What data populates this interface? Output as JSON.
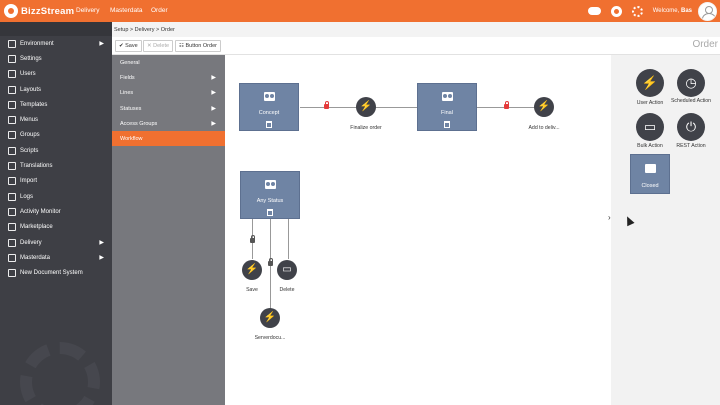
{
  "app": {
    "name": "BizzStream"
  },
  "topnav": [
    {
      "label": "Delivery"
    },
    {
      "label": "Masterdata"
    },
    {
      "label": "Order"
    }
  ],
  "user": {
    "welcome": "Welcome,",
    "name": "Bas"
  },
  "icons": {
    "cloud": "cloud-icon",
    "help": "lifebuoy-icon",
    "settings": "gear-icon"
  },
  "colors": {
    "accent": "#f07030",
    "sidebar": "#3e3f45",
    "subnav": "#77787d",
    "node": "#6f84a4",
    "action": "#404249",
    "lock": "#e53b3b"
  },
  "sidebar": {
    "items": [
      {
        "label": "Environment",
        "icon": "globe-icon",
        "has_children": true
      },
      {
        "label": "Settings",
        "icon": "wrench-icon",
        "has_children": false
      },
      {
        "label": "Users",
        "icon": "users-icon",
        "has_children": false
      },
      {
        "label": "Layouts",
        "icon": "layout-icon",
        "has_children": false
      },
      {
        "label": "Templates",
        "icon": "template-icon",
        "has_children": false
      },
      {
        "label": "Menus",
        "icon": "menu-icon",
        "has_children": false
      },
      {
        "label": "Groups",
        "icon": "groups-icon",
        "has_children": false
      },
      {
        "label": "Scripts",
        "icon": "code-icon",
        "has_children": false
      },
      {
        "label": "Translations",
        "icon": "translate-icon",
        "has_children": false
      },
      {
        "label": "Import",
        "icon": "import-icon",
        "has_children": false
      },
      {
        "label": "Logs",
        "icon": "log-icon",
        "has_children": false
      },
      {
        "label": "Activity Monitor",
        "icon": "monitor-icon",
        "has_children": false
      },
      {
        "label": "Marketplace",
        "icon": "cart-icon",
        "has_children": false
      },
      {
        "label": "Delivery",
        "icon": "truck-icon",
        "has_children": true
      },
      {
        "label": "Masterdata",
        "icon": "database-icon",
        "has_children": true
      },
      {
        "label": "New Document System",
        "icon": "plus-icon",
        "has_children": false
      }
    ]
  },
  "breadcrumb": {
    "text": "Setup  >  Delivery  >  Order"
  },
  "toolbar": {
    "save": "Save",
    "delete": "Delete",
    "button_order": "Button Order"
  },
  "page": {
    "title": "Order"
  },
  "subnav": {
    "items": [
      {
        "label": "General",
        "has_children": false,
        "active": false
      },
      {
        "label": "Fields",
        "has_children": true,
        "active": false
      },
      {
        "label": "Lines",
        "has_children": true,
        "active": false
      },
      {
        "label": "Statuses",
        "has_children": true,
        "active": false
      },
      {
        "label": "Access Groups",
        "has_children": true,
        "active": false
      },
      {
        "label": "Workflow",
        "has_children": false,
        "active": true
      }
    ]
  },
  "workflow": {
    "statuses": [
      {
        "label": "Concept"
      },
      {
        "label": "Final"
      },
      {
        "label": "Any Status"
      }
    ],
    "actions": [
      {
        "label": "Finalize order"
      },
      {
        "label": "Add to deliv..."
      },
      {
        "label": "Save"
      },
      {
        "label": "Delete"
      },
      {
        "label": "Serverdocu..."
      }
    ]
  },
  "palette": {
    "items": [
      {
        "label": "User Action"
      },
      {
        "label": "Scheduled Action"
      },
      {
        "label": "Bulk Action"
      },
      {
        "label": "REST Action"
      }
    ],
    "closed_status": {
      "label": "Closed"
    }
  }
}
